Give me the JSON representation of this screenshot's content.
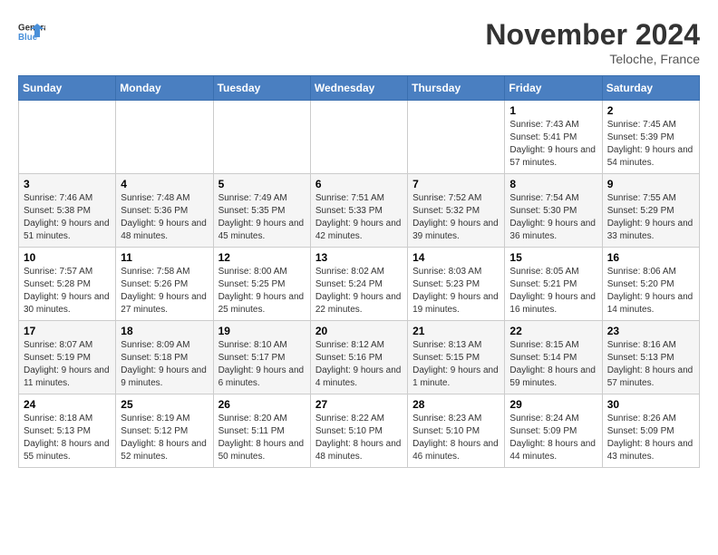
{
  "header": {
    "logo_line1": "General",
    "logo_line2": "Blue",
    "month_title": "November 2024",
    "location": "Teloche, France"
  },
  "weekdays": [
    "Sunday",
    "Monday",
    "Tuesday",
    "Wednesday",
    "Thursday",
    "Friday",
    "Saturday"
  ],
  "weeks": [
    [
      {
        "day": "",
        "info": ""
      },
      {
        "day": "",
        "info": ""
      },
      {
        "day": "",
        "info": ""
      },
      {
        "day": "",
        "info": ""
      },
      {
        "day": "",
        "info": ""
      },
      {
        "day": "1",
        "info": "Sunrise: 7:43 AM\nSunset: 5:41 PM\nDaylight: 9 hours and 57 minutes."
      },
      {
        "day": "2",
        "info": "Sunrise: 7:45 AM\nSunset: 5:39 PM\nDaylight: 9 hours and 54 minutes."
      }
    ],
    [
      {
        "day": "3",
        "info": "Sunrise: 7:46 AM\nSunset: 5:38 PM\nDaylight: 9 hours and 51 minutes."
      },
      {
        "day": "4",
        "info": "Sunrise: 7:48 AM\nSunset: 5:36 PM\nDaylight: 9 hours and 48 minutes."
      },
      {
        "day": "5",
        "info": "Sunrise: 7:49 AM\nSunset: 5:35 PM\nDaylight: 9 hours and 45 minutes."
      },
      {
        "day": "6",
        "info": "Sunrise: 7:51 AM\nSunset: 5:33 PM\nDaylight: 9 hours and 42 minutes."
      },
      {
        "day": "7",
        "info": "Sunrise: 7:52 AM\nSunset: 5:32 PM\nDaylight: 9 hours and 39 minutes."
      },
      {
        "day": "8",
        "info": "Sunrise: 7:54 AM\nSunset: 5:30 PM\nDaylight: 9 hours and 36 minutes."
      },
      {
        "day": "9",
        "info": "Sunrise: 7:55 AM\nSunset: 5:29 PM\nDaylight: 9 hours and 33 minutes."
      }
    ],
    [
      {
        "day": "10",
        "info": "Sunrise: 7:57 AM\nSunset: 5:28 PM\nDaylight: 9 hours and 30 minutes."
      },
      {
        "day": "11",
        "info": "Sunrise: 7:58 AM\nSunset: 5:26 PM\nDaylight: 9 hours and 27 minutes."
      },
      {
        "day": "12",
        "info": "Sunrise: 8:00 AM\nSunset: 5:25 PM\nDaylight: 9 hours and 25 minutes."
      },
      {
        "day": "13",
        "info": "Sunrise: 8:02 AM\nSunset: 5:24 PM\nDaylight: 9 hours and 22 minutes."
      },
      {
        "day": "14",
        "info": "Sunrise: 8:03 AM\nSunset: 5:23 PM\nDaylight: 9 hours and 19 minutes."
      },
      {
        "day": "15",
        "info": "Sunrise: 8:05 AM\nSunset: 5:21 PM\nDaylight: 9 hours and 16 minutes."
      },
      {
        "day": "16",
        "info": "Sunrise: 8:06 AM\nSunset: 5:20 PM\nDaylight: 9 hours and 14 minutes."
      }
    ],
    [
      {
        "day": "17",
        "info": "Sunrise: 8:07 AM\nSunset: 5:19 PM\nDaylight: 9 hours and 11 minutes."
      },
      {
        "day": "18",
        "info": "Sunrise: 8:09 AM\nSunset: 5:18 PM\nDaylight: 9 hours and 9 minutes."
      },
      {
        "day": "19",
        "info": "Sunrise: 8:10 AM\nSunset: 5:17 PM\nDaylight: 9 hours and 6 minutes."
      },
      {
        "day": "20",
        "info": "Sunrise: 8:12 AM\nSunset: 5:16 PM\nDaylight: 9 hours and 4 minutes."
      },
      {
        "day": "21",
        "info": "Sunrise: 8:13 AM\nSunset: 5:15 PM\nDaylight: 9 hours and 1 minute."
      },
      {
        "day": "22",
        "info": "Sunrise: 8:15 AM\nSunset: 5:14 PM\nDaylight: 8 hours and 59 minutes."
      },
      {
        "day": "23",
        "info": "Sunrise: 8:16 AM\nSunset: 5:13 PM\nDaylight: 8 hours and 57 minutes."
      }
    ],
    [
      {
        "day": "24",
        "info": "Sunrise: 8:18 AM\nSunset: 5:13 PM\nDaylight: 8 hours and 55 minutes."
      },
      {
        "day": "25",
        "info": "Sunrise: 8:19 AM\nSunset: 5:12 PM\nDaylight: 8 hours and 52 minutes."
      },
      {
        "day": "26",
        "info": "Sunrise: 8:20 AM\nSunset: 5:11 PM\nDaylight: 8 hours and 50 minutes."
      },
      {
        "day": "27",
        "info": "Sunrise: 8:22 AM\nSunset: 5:10 PM\nDaylight: 8 hours and 48 minutes."
      },
      {
        "day": "28",
        "info": "Sunrise: 8:23 AM\nSunset: 5:10 PM\nDaylight: 8 hours and 46 minutes."
      },
      {
        "day": "29",
        "info": "Sunrise: 8:24 AM\nSunset: 5:09 PM\nDaylight: 8 hours and 44 minutes."
      },
      {
        "day": "30",
        "info": "Sunrise: 8:26 AM\nSunset: 5:09 PM\nDaylight: 8 hours and 43 minutes."
      }
    ]
  ]
}
